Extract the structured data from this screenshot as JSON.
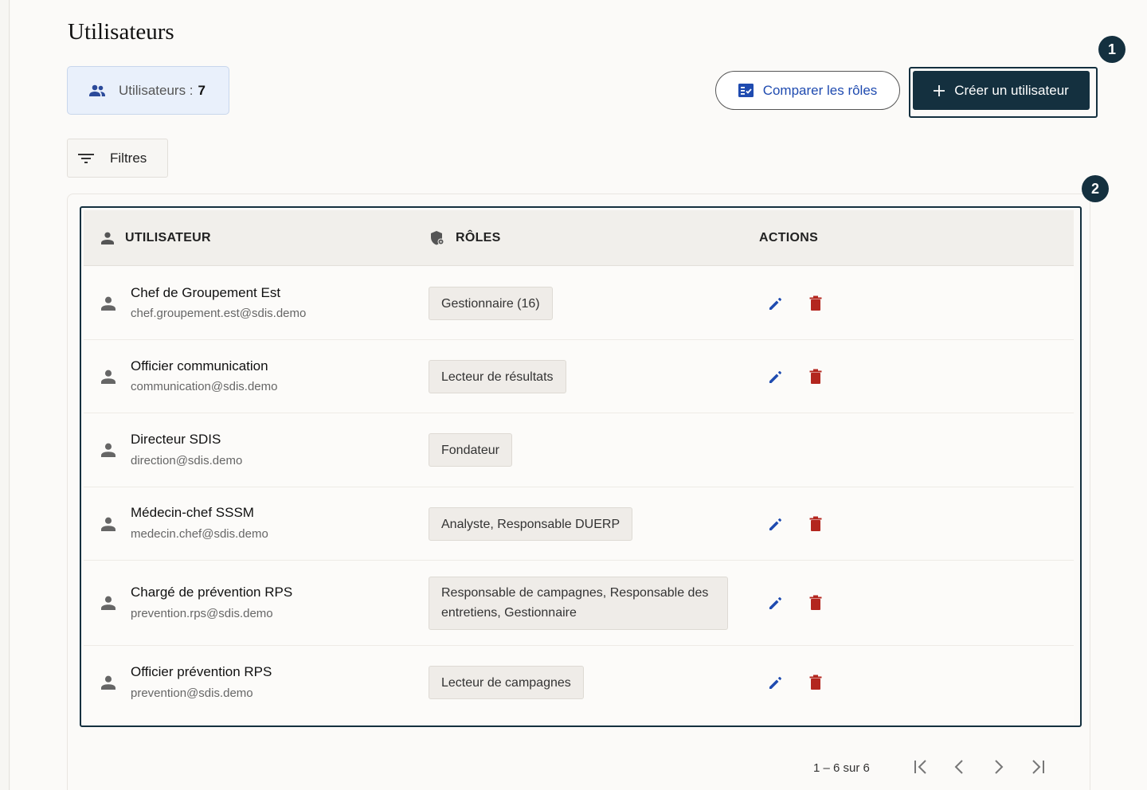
{
  "page": {
    "title": "Utilisateurs"
  },
  "summary": {
    "label": "Utilisateurs :",
    "count": "7"
  },
  "actions": {
    "compare_label": "Comparer les rôles",
    "create_label": "Créer un utilisateur"
  },
  "badges": {
    "first": "1",
    "second": "2"
  },
  "filters": {
    "label": "Filtres"
  },
  "table": {
    "headers": {
      "user": "UTILISATEUR",
      "roles": "RÔLES",
      "actions": "ACTIONS"
    },
    "rows": [
      {
        "name": "Chef de Groupement Est",
        "email": "chef.groupement.est@sdis.demo",
        "roles": "Gestionnaire (16)",
        "has_actions": true
      },
      {
        "name": "Officier communication",
        "email": "communication@sdis.demo",
        "roles": "Lecteur de résultats",
        "has_actions": true
      },
      {
        "name": "Directeur SDIS",
        "email": "direction@sdis.demo",
        "roles": "Fondateur",
        "has_actions": false
      },
      {
        "name": "Médecin-chef SSSM",
        "email": "medecin.chef@sdis.demo",
        "roles": "Analyste, Responsable DUERP",
        "has_actions": true
      },
      {
        "name": "Chargé de prévention RPS",
        "email": "prevention.rps@sdis.demo",
        "roles": "Responsable de campagnes, Responsable des entretiens, Gestionnaire",
        "has_actions": true
      },
      {
        "name": "Officier prévention RPS",
        "email": "prevention@sdis.demo",
        "roles": "Lecteur de campagnes",
        "has_actions": true
      }
    ]
  },
  "pagination": {
    "range": "1 – 6 sur 6"
  },
  "colors": {
    "primary": "#14303f",
    "link": "#1f4bb0",
    "delete": "#b3261e",
    "summary_bg": "#e9f0fb"
  }
}
